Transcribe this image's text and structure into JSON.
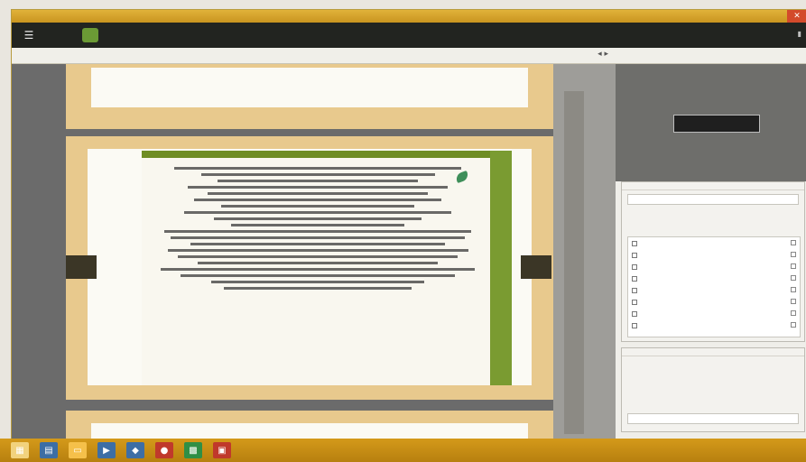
{
  "window": {
    "title": "",
    "close_label": "✕"
  },
  "toolbar": {
    "menu_icon": "menu-icon",
    "items": [
      "",
      "",
      "",
      "",
      ""
    ]
  },
  "urlbar": {
    "url": ""
  },
  "viewer": {
    "prev_label": "",
    "next_label": ""
  },
  "side": {
    "header": "",
    "thumb_button": "",
    "panel_title": "",
    "search_placeholder": "",
    "group_label": "",
    "list_items": [
      "",
      "",
      "",
      "",
      "",
      "",
      "",
      ""
    ],
    "panel2_title": "",
    "panel2_text": ""
  },
  "taskbar": {
    "clock": ""
  },
  "colors": {
    "accent_green": "#6f8d24",
    "window_frame": "#d7c27b",
    "taskbar": "#d49a1a",
    "titlebar": "#e1b23a"
  }
}
